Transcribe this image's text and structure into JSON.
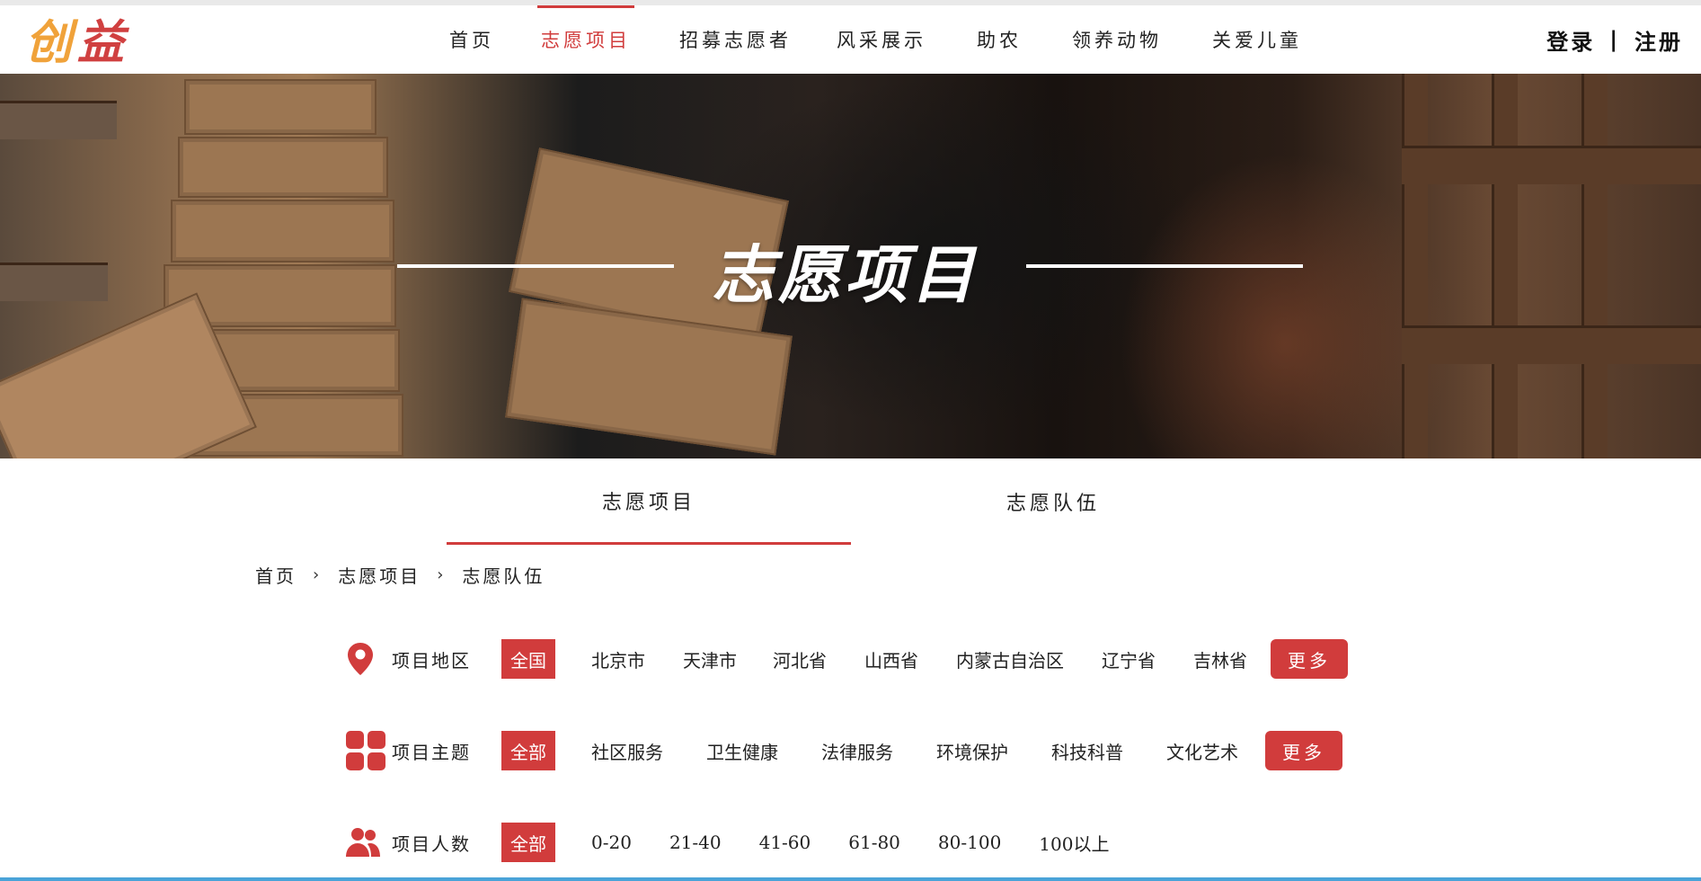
{
  "logo": {
    "part1": "创",
    "part2": "益"
  },
  "nav": {
    "items": [
      {
        "label": "首页"
      },
      {
        "label": "志愿项目"
      },
      {
        "label": "招募志愿者"
      },
      {
        "label": "风采展示"
      },
      {
        "label": "助农"
      },
      {
        "label": "领养动物"
      },
      {
        "label": "关爱儿童"
      }
    ],
    "active_index": 1
  },
  "auth": {
    "login": "登录",
    "separator": "|",
    "register": "注册"
  },
  "banner": {
    "title": "志愿项目"
  },
  "tabs": [
    {
      "label": "志愿项目",
      "active": true
    },
    {
      "label": "志愿队伍",
      "active": false
    }
  ],
  "breadcrumb": [
    {
      "label": "首页"
    },
    {
      "label": "志愿项目"
    },
    {
      "label": "志愿队伍"
    }
  ],
  "filters": {
    "region": {
      "icon": "location-pin-icon",
      "label": "项目地区",
      "selected": "全国",
      "options": [
        "北京市",
        "天津市",
        "河北省",
        "山西省",
        "内蒙古自治区",
        "辽宁省",
        "吉林省"
      ],
      "more": "更多"
    },
    "theme": {
      "icon": "grid-icon",
      "label": "项目主题",
      "selected": "全部",
      "options": [
        "社区服务",
        "卫生健康",
        "法律服务",
        "环境保护",
        "科技科普",
        "文化艺术"
      ],
      "more": "更多"
    },
    "size": {
      "icon": "people-icon",
      "label": "项目人数",
      "selected": "全部",
      "options": [
        "0-20",
        "21-40",
        "41-60",
        "61-80",
        "80-100",
        "100以上"
      ]
    }
  },
  "colors": {
    "accent": "#d13c3c",
    "logo_orange": "#f0a23a"
  }
}
